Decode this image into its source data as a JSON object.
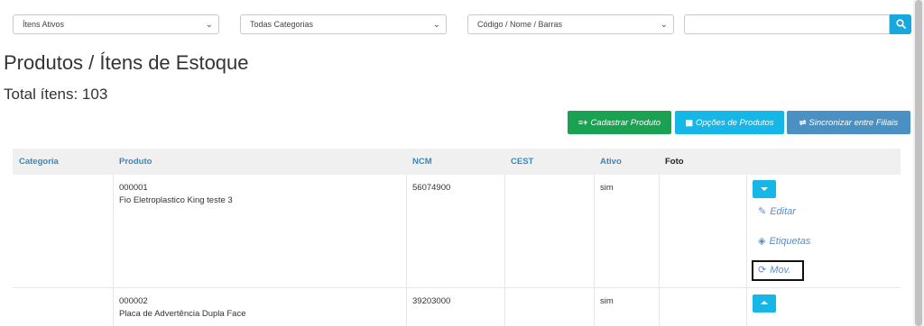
{
  "filters": {
    "status_select": "Ítens Ativos",
    "category_select": "Todas Categorias",
    "search_field_select": "Código / Nome / Barras",
    "search_value": ""
  },
  "page": {
    "title": "Produtos / Ítens de Estoque",
    "total": "Total ítens: 103"
  },
  "actions": {
    "cadastrar": "Cadastrar Produto",
    "opcoes": "Opções de Produtos",
    "sincronizar": "Sincronizar entre Filiais"
  },
  "table": {
    "headers": [
      "Categoria",
      "Produto",
      "NCM",
      "CEST",
      "Ativo",
      "Foto"
    ],
    "rows": [
      {
        "categoria": "",
        "codigo": "000001",
        "nome": "Fio Eletroplastico King teste 3",
        "ncm": "56074900",
        "cest": "",
        "ativo": "sim"
      },
      {
        "categoria": "",
        "codigo": "000002",
        "nome": "Placa de Advertência Dupla Face",
        "ncm": "39203000",
        "cest": "",
        "ativo": "sim"
      }
    ]
  },
  "row_menu": {
    "editar": "Editar",
    "etiquetas": "Etiquetas",
    "mov": "Mov."
  },
  "colors": {
    "accent": "#16b6e6",
    "success": "#1aa152",
    "steel": "#4a90c2",
    "header_link": "#3b86bd"
  }
}
